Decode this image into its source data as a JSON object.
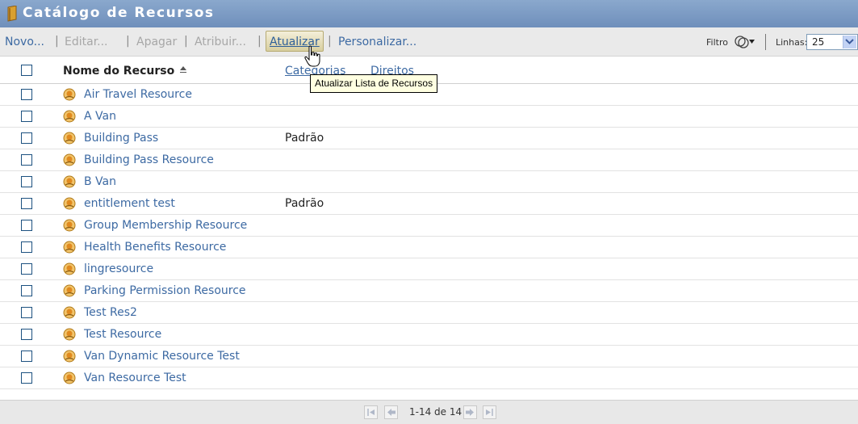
{
  "window": {
    "title": "Catálogo de Recursos"
  },
  "toolbar": {
    "novo": "Novo...",
    "editar": "Editar...",
    "apagar": "Apagar",
    "atribuir": "Atribuir...",
    "atualizar": "Atualizar",
    "personalizar": "Personalizar...",
    "separator": "|",
    "filtro_label": "Filtro",
    "linhas_label": "Linhas:",
    "linhas_value": "25"
  },
  "table": {
    "columns": {
      "name": "Nome do Recurso",
      "categorias": "Categorias",
      "direitos": "Direitos"
    },
    "rows": [
      {
        "name": "Air Travel Resource",
        "category": ""
      },
      {
        "name": "A Van",
        "category": ""
      },
      {
        "name": "Building Pass",
        "category": "Padrão"
      },
      {
        "name": "Building Pass Resource",
        "category": ""
      },
      {
        "name": "B Van",
        "category": ""
      },
      {
        "name": "entitlement test",
        "category": "Padrão"
      },
      {
        "name": "Group Membership Resource",
        "category": ""
      },
      {
        "name": "Health Benefits Resource",
        "category": ""
      },
      {
        "name": "lingresource",
        "category": ""
      },
      {
        "name": "Parking Permission Resource",
        "category": ""
      },
      {
        "name": "Test Res2",
        "category": ""
      },
      {
        "name": "Test Resource",
        "category": ""
      },
      {
        "name": "Van Dynamic Resource Test",
        "category": ""
      },
      {
        "name": "Van Resource Test",
        "category": ""
      }
    ]
  },
  "tooltip": {
    "text": "Atualizar Lista de Recursos"
  },
  "pager": {
    "text": "1-14 de 14"
  },
  "colors": {
    "title_bar": "#7b98c2",
    "link": "#3d6aa3",
    "tooltip_bg": "#ffffe1",
    "resource_icon": "#e9a33a"
  }
}
